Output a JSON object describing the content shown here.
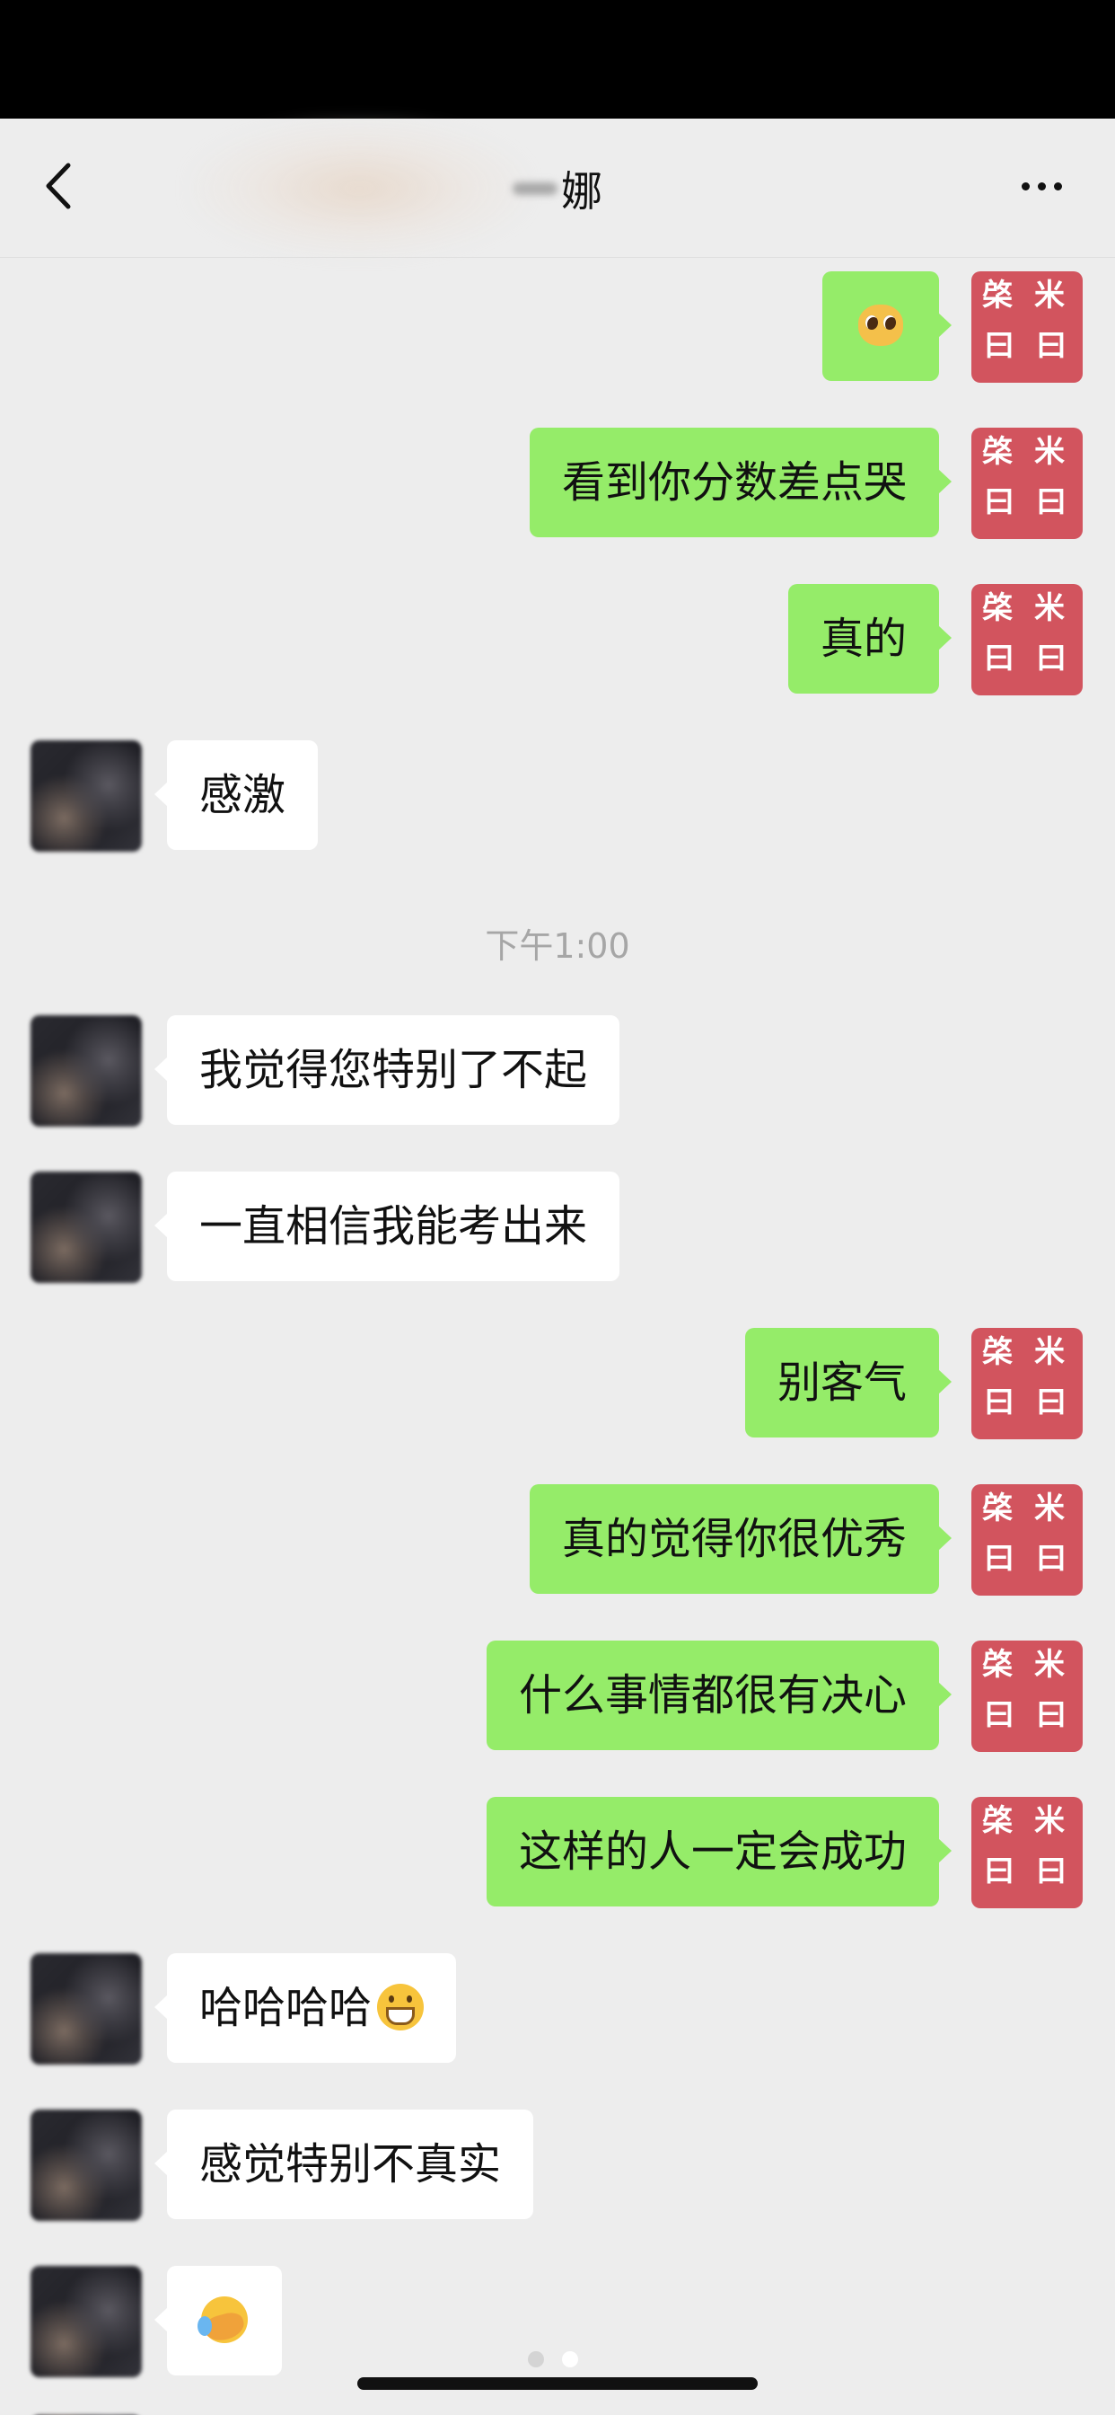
{
  "header": {
    "title": "娜",
    "back_icon": "chevron-left-icon",
    "more_icon": "more-dots-icon"
  },
  "my_avatar": {
    "glyphs": [
      "棨",
      "米",
      "曰",
      "曰"
    ],
    "color": "#d2545e"
  },
  "messages": [
    {
      "sender": "me",
      "text": "",
      "emoji": "pleading-face"
    },
    {
      "sender": "me",
      "text": "看到你分数差点哭"
    },
    {
      "sender": "me",
      "text": "真的"
    },
    {
      "sender": "them",
      "text": "感激"
    },
    {
      "sender": "them",
      "text": "我觉得您特别了不起"
    },
    {
      "sender": "them",
      "text": "一直相信我能考出来"
    },
    {
      "sender": "me",
      "text": "别客气"
    },
    {
      "sender": "me",
      "text": "真的觉得你很优秀"
    },
    {
      "sender": "me",
      "text": "什么事情都很有决心"
    },
    {
      "sender": "me",
      "text": "这样的人一定会成功"
    },
    {
      "sender": "them",
      "text": "哈哈哈哈",
      "emoji": "grinning-face"
    },
    {
      "sender": "them",
      "text": "感觉特别不真实"
    },
    {
      "sender": "them",
      "text": "",
      "emoji": "rolling-on-floor-laughing-face"
    }
  ],
  "timestamp": "下午1:00",
  "colors": {
    "my_bubble": "#95ec69",
    "their_bubble": "#ffffff",
    "background": "#ededed",
    "timestamp": "#a6a6a6"
  }
}
